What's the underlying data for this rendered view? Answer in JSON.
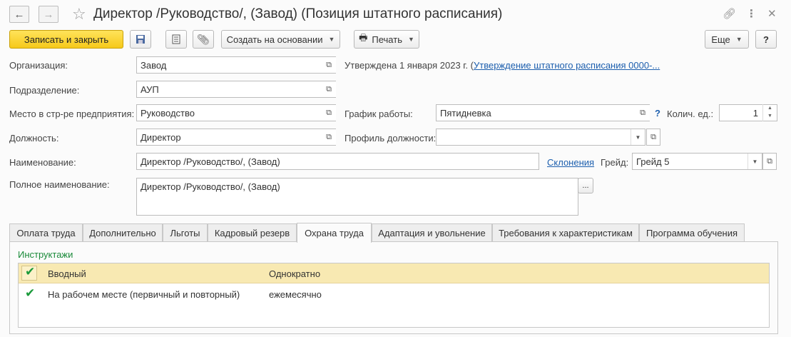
{
  "header": {
    "title": "Директор /Руководство/, (Завод) (Позиция штатного расписания)"
  },
  "toolbar": {
    "save_close": "Записать и закрыть",
    "create_based": "Создать на основании",
    "print": "Печать",
    "more": "Еще",
    "help": "?"
  },
  "form": {
    "organization_label": "Организация:",
    "organization_value": "Завод",
    "approved_text": "Утверждена 1 января 2023 г. (",
    "approved_link": "Утверждение штатного расписания 0000-...",
    "department_label": "Подразделение:",
    "department_value": "АУП",
    "place_label": "Место в стр-ре предприятия:",
    "place_value": "Руководство",
    "schedule_label": "График работы:",
    "schedule_value": "Пятидневка",
    "schedule_help": "?",
    "units_label": "Колич. ед.:",
    "units_value": "1",
    "position_label": "Должность:",
    "position_value": "Директор",
    "profile_label": "Профиль должности:",
    "profile_value": "",
    "name_label": "Наименование:",
    "name_value": "Директор /Руководство/, (Завод)",
    "declension_link": "Склонения",
    "grade_label": "Грейд:",
    "grade_value": "Грейд 5",
    "full_name_label": "Полное наименование:",
    "full_name_value": "Директор /Руководство/, (Завод)",
    "ellipsis": "..."
  },
  "tabs": [
    {
      "label": "Оплата труда"
    },
    {
      "label": "Дополнительно"
    },
    {
      "label": "Льготы"
    },
    {
      "label": "Кадровый резерв"
    },
    {
      "label": "Охрана труда"
    },
    {
      "label": "Адаптация и увольнение"
    },
    {
      "label": "Требования к характеристикам"
    },
    {
      "label": "Программа обучения"
    }
  ],
  "active_tab": "Охрана труда",
  "instructions": {
    "title": "Инструктажи",
    "rows": [
      {
        "checked": true,
        "name": "Вводный",
        "frequency": "Однократно"
      },
      {
        "checked": true,
        "name": "На рабочем месте (первичный и повторный)",
        "frequency": "ежемесячно"
      }
    ]
  },
  "colors": {
    "primary_button": "#f6c91a",
    "link": "#1d5fae",
    "group_title": "#1a8a3a",
    "selected_row": "#f8e9b2"
  }
}
